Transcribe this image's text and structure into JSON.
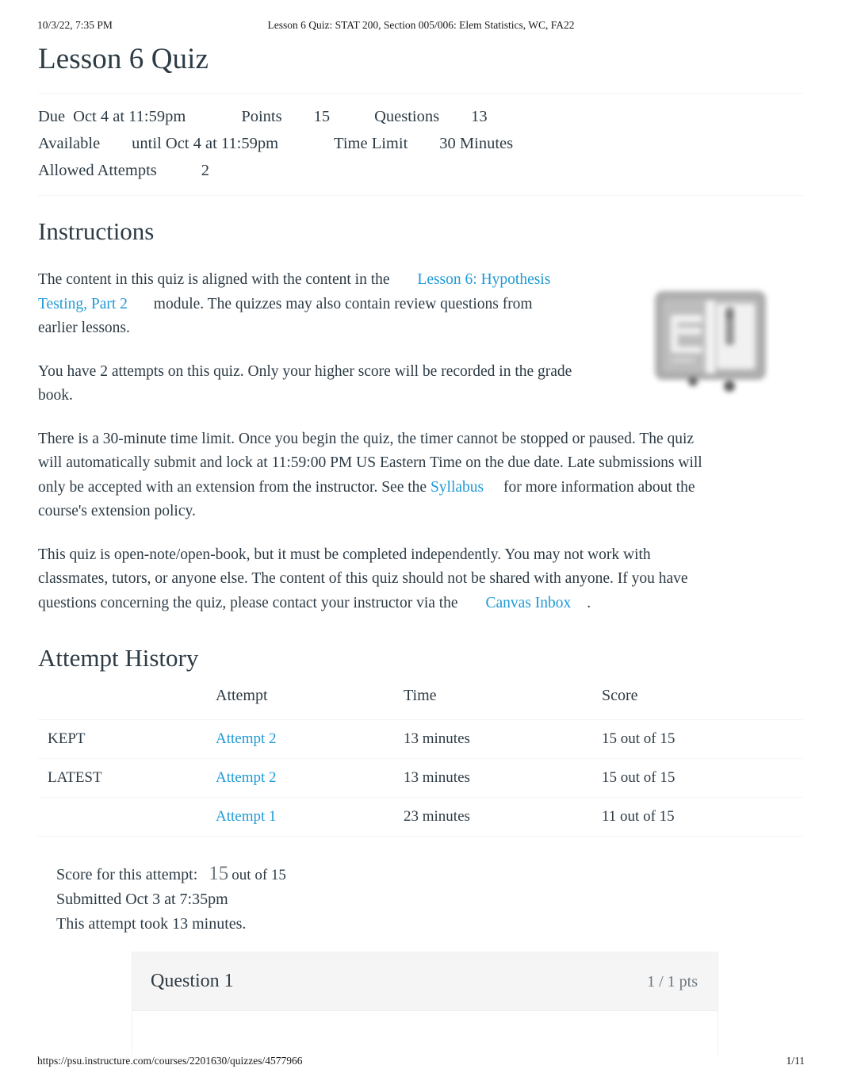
{
  "print_header": {
    "timestamp": "10/3/22, 7:35 PM",
    "document_title": "Lesson 6 Quiz: STAT 200, Section 005/006: Elem Statistics, WC, FA22"
  },
  "quiz": {
    "title": "Lesson 6 Quiz",
    "details": {
      "due_label": "Due",
      "due_value": "Oct 4 at 11:59pm",
      "points_label": "Points",
      "points_value": "15",
      "questions_label": "Questions",
      "questions_value": "13",
      "available_label": "Available",
      "available_value": "until Oct 4 at 11:59pm",
      "time_limit_label": "Time Limit",
      "time_limit_value": "30 Minutes",
      "allowed_attempts_label": "Allowed Attempts",
      "allowed_attempts_value": "2"
    }
  },
  "instructions": {
    "heading": "Instructions",
    "p1_before": "The content in this quiz is aligned with the content in the",
    "p1_link": "Lesson 6: Hypothesis Testing, Part 2",
    "p1_after": "module. The quizzes may also contain review questions from earlier lessons.",
    "p2": "You have 2 attempts on this quiz. Only your higher score will be recorded in the grade book.",
    "p3_before": "There is a 30-minute time limit. Once you begin the quiz, the timer cannot be stopped or paused. The quiz will automatically submit and lock at 11:59:00 PM US Eastern Time on the due date. Late submissions will only be accepted with an extension from the instructor. See the",
    "p3_link": "Syllabus",
    "p3_after": "for more information about the course's extension policy.",
    "p4_before": "This quiz is open-note/open-book, but it must be completed independently. You may not work with classmates, tutors, or anyone else. The content of this quiz should not be shared with anyone. If you have questions concerning the quiz, please contact your instructor via the",
    "p4_link": "Canvas Inbox",
    "p4_after": ".",
    "image_alt": "open-book-icon"
  },
  "attempt_history": {
    "heading": "Attempt History",
    "columns": [
      "",
      "Attempt",
      "Time",
      "Score"
    ],
    "rows": [
      {
        "status": "KEPT",
        "attempt": "Attempt 2",
        "time": "13 minutes",
        "score": "15 out of 15"
      },
      {
        "status": "LATEST",
        "attempt": "Attempt 2",
        "time": "13 minutes",
        "score": "15 out of 15"
      },
      {
        "status": "",
        "attempt": "Attempt 1",
        "time": "23 minutes",
        "score": "11 out of 15"
      }
    ]
  },
  "score_summary": {
    "score_label": "Score for this attempt:",
    "score_value": "15",
    "score_out_of": "out of 15",
    "submitted": "Submitted Oct 3 at 7:35pm",
    "duration": "This attempt took 13 minutes."
  },
  "question": {
    "name": "Question 1",
    "points": "1 / 1 pts"
  },
  "print_footer": {
    "url": "https://psu.instructure.com/courses/2201630/quizzes/4577966",
    "page": "1/11"
  },
  "colors": {
    "link": "#1f9ad6",
    "text": "#2d3b45",
    "muted": "#6b7780",
    "question_header_bg": "#f5f5f5"
  }
}
